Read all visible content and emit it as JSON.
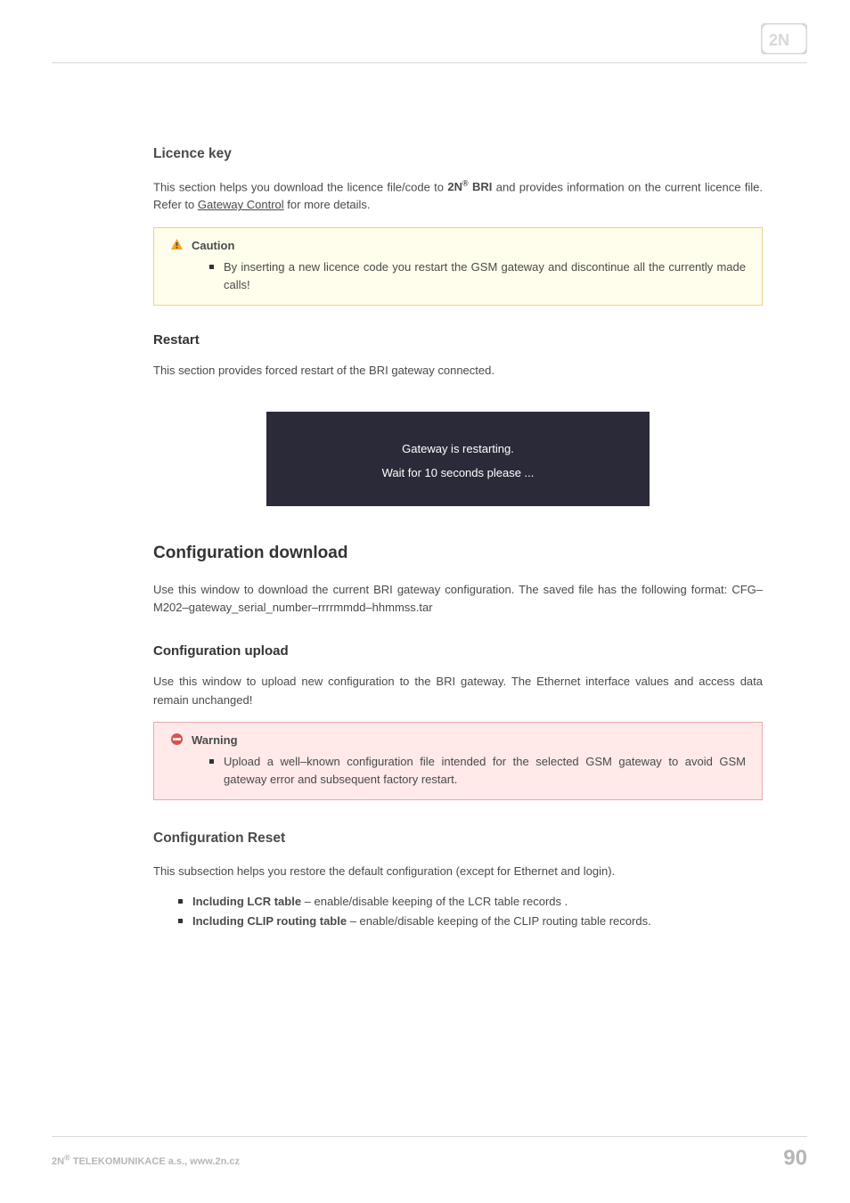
{
  "sections": {
    "licence": {
      "title": "Licence key",
      "p1a": "This section helps you download the licence file/code to ",
      "brand_prefix": "2N",
      "reg": "®",
      "brand_suffix": "BRI",
      "p1b": " and provides information on the current licence file. Refer to ",
      "link": "Gateway Control",
      "p1c": " for more details.",
      "caution": {
        "title": "Caution",
        "item": "By inserting a new licence code you restart the GSM gateway and discontinue all the currently made calls!"
      }
    },
    "restart": {
      "title": "Restart",
      "p": "This section provides forced restart of the BRI gateway connected.",
      "panel": {
        "line1": "Gateway is restarting.",
        "line2": "Wait for 10 seconds please ..."
      }
    },
    "config_download": {
      "title": "Configuration download",
      "p": "Use this window to download the current BRI gateway configuration. The saved file has the following format: CFG–M202–gateway_serial_number–rrrrmmdd–hhmmss.tar"
    },
    "config_upload": {
      "title": "Configuration upload",
      "p": "Use this window to upload new configuration to the BRI gateway. The Ethernet interface values and access data remain unchanged!",
      "warning": {
        "title": "Warning",
        "item": "Upload a well–known configuration file intended for the selected GSM gateway to avoid GSM gateway error and subsequent factory restart."
      }
    },
    "config_reset": {
      "title": "Configuration Reset",
      "p": "This subsection helps you restore the default configuration (except for Ethernet and login).",
      "items": [
        {
          "term": "Including LCR table",
          "desc": " – enable/disable keeping of the LCR table records ."
        },
        {
          "term": "Including CLIP routing table",
          "desc": " – enable/disable keeping of the CLIP routing table records."
        }
      ]
    }
  },
  "footer": {
    "company_prefix": "2N",
    "reg": "®",
    "company_suffix": "TELEKOMUNIKACE a.s., www.2n.cz",
    "page": "90"
  }
}
